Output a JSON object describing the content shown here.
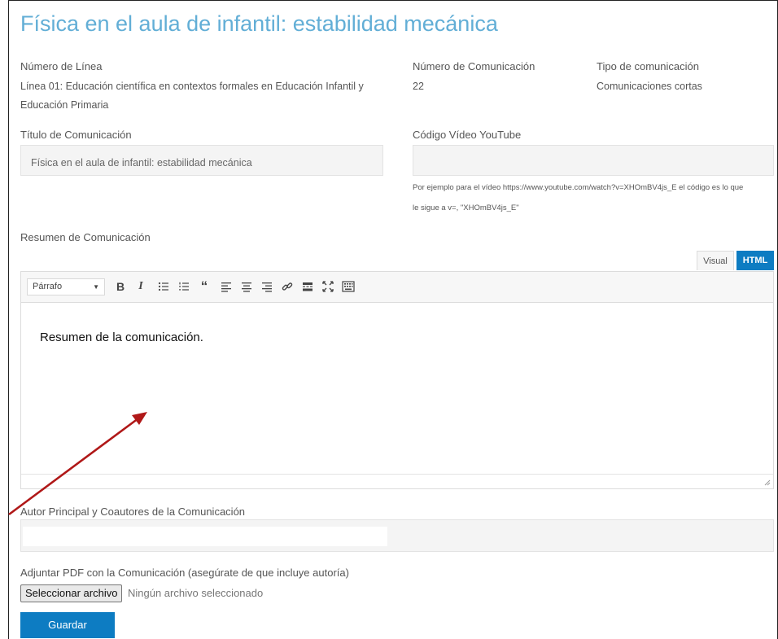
{
  "page": {
    "title": "Física en el aula de infantil: estabilidad mecánica"
  },
  "fields": {
    "line_label": "Número de Línea",
    "line_value_1": "Línea 01: Educación científica en contextos formales en Educación Infantil y",
    "line_value_2": "Educación Primaria",
    "comm_number_label": "Número de Comunicación",
    "comm_number_value": "22",
    "comm_type_label": "Tipo de comunicación",
    "comm_type_value": "Comunicaciones cortas",
    "comm_title_label": "Título de Comunicación",
    "comm_title_value": "Física en el aula de infantil: estabilidad mecánica",
    "youtube_label": "Código Vídeo YouTube",
    "youtube_value": "",
    "youtube_hint_1": "Por ejemplo para el vídeo https://www.youtube.com/watch?v=XHOmBV4js_E el código es lo que",
    "youtube_hint_2": "le sigue a v=, \"XHOmBV4js_E\"",
    "summary_label": "Resumen de Comunicación",
    "authors_label": "Autor Principal y Coautores de la Comunicación",
    "authors_value": "",
    "pdf_label": "Adjuntar PDF con la Comunicación (asegúrate de que incluye autoría)"
  },
  "editor": {
    "tabs": {
      "visual": "Visual",
      "html": "HTML",
      "active": "HTML"
    },
    "format_select": "Párrafo",
    "toolbar_icons": [
      "bold-icon",
      "italic-icon",
      "bullet-list-icon",
      "numbered-list-icon",
      "blockquote-icon",
      "align-left-icon",
      "align-center-icon",
      "align-right-icon",
      "link-icon",
      "read-more-icon",
      "fullscreen-icon",
      "toolbar-toggle-icon"
    ],
    "content": "Resumen de la comunicación."
  },
  "file_input": {
    "button_label": "Seleccionar archivo",
    "status": "Ningún archivo seleccionado"
  },
  "actions": {
    "save_label": "Guardar"
  },
  "colors": {
    "title": "#62aed6",
    "primary_button": "#0d7cc2",
    "annotation_arrow": "#b01818"
  }
}
